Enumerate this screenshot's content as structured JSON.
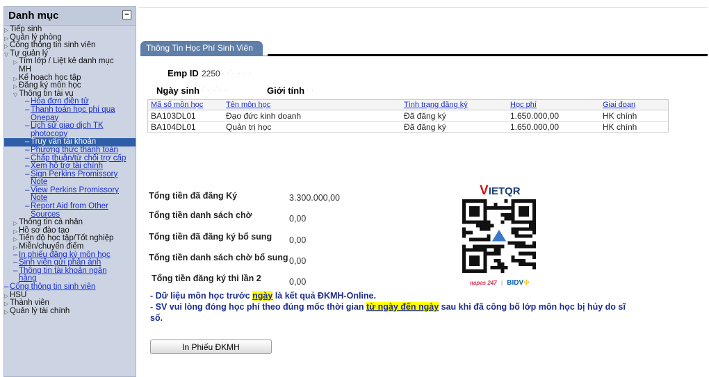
{
  "sidebar": {
    "title": "Danh mục",
    "toggle": "−",
    "items": [
      {
        "text": "Tiếp sinh",
        "level": 0,
        "arrow": "▷",
        "link": false
      },
      {
        "text": "Quản lý phòng",
        "level": 0,
        "arrow": "▷",
        "link": false
      },
      {
        "text": "Cổng thông tin sinh viên",
        "level": 0,
        "arrow": "▷",
        "link": false
      },
      {
        "text": "Tự quản lý",
        "level": 0,
        "arrow": "▽",
        "link": false
      },
      {
        "text": "Tìm lớp / Liệt kê danh mục MH",
        "level": 1,
        "arrow": "▷",
        "link": false
      },
      {
        "text": "Kế hoạch học tập",
        "level": 1,
        "arrow": "▷",
        "link": false
      },
      {
        "text": "Đăng ký môn học",
        "level": 1,
        "arrow": "▷",
        "link": false
      },
      {
        "text": "Thông tin tài vụ",
        "level": 1,
        "arrow": "▽",
        "link": false
      },
      {
        "text": "Hóa đơn điện tử",
        "level": 2,
        "link": true
      },
      {
        "text": "Thanh toán học phí qua Onepay",
        "level": 2,
        "link": true
      },
      {
        "text": "Lịch sử giao dịch TK photocopy",
        "level": 2,
        "link": true
      },
      {
        "text": "Truy vấn tài khoản",
        "level": 2,
        "link": true,
        "selected": true
      },
      {
        "text": "Phương thức thanh toán",
        "level": 2,
        "link": true
      },
      {
        "text": "Chấp thuận/từ chối trợ cấp",
        "level": 2,
        "link": true
      },
      {
        "text": "Xem hỗ trợ tài chính",
        "level": 2,
        "link": true
      },
      {
        "text": "Sign Perkins Promissory Note",
        "level": 2,
        "link": true
      },
      {
        "text": "View Perkins Promissory Note",
        "level": 2,
        "link": true
      },
      {
        "text": "Report Aid from Other Sources",
        "level": 2,
        "link": true
      },
      {
        "text": "Thông tin cá nhân",
        "level": 1,
        "arrow": "▷",
        "link": false
      },
      {
        "text": "Hồ sơ đào tạo",
        "level": 1,
        "arrow": "▷",
        "link": false
      },
      {
        "text": "Tiến độ học tập/Tốt nghiệp",
        "level": 1,
        "arrow": "▷",
        "link": false
      },
      {
        "text": "Miễn/chuyển điểm",
        "level": 1,
        "arrow": "▷",
        "link": false
      },
      {
        "text": "In phiếu đăng ký môn học",
        "level": 1,
        "dash": true,
        "link": true
      },
      {
        "text": "Sinh viên gửi phản ánh",
        "level": 1,
        "dash": true,
        "link": true
      },
      {
        "text": "Thông tin tài khoản ngân hàng",
        "level": 1,
        "dash": true,
        "link": true
      },
      {
        "text": "Cổng thông tin sinh viên",
        "level": 0,
        "dash": true,
        "link": true
      },
      {
        "text": "HSU",
        "level": 0,
        "arrow": "▷",
        "link": false
      },
      {
        "text": "Thành viên",
        "level": 0,
        "arrow": "▷",
        "link": false
      },
      {
        "text": "Quản lý tài chính",
        "level": 0,
        "arrow": "▷",
        "link": false
      }
    ]
  },
  "tab": {
    "label": "Thông Tin Học Phí Sinh Viên"
  },
  "info": {
    "emp_label": "Emp ID",
    "emp_value": "2250",
    "dob_label": "Ngày sinh",
    "gender_label": "Giới tính"
  },
  "table": {
    "headers": [
      "Mã số môn học",
      "Tên môn học",
      "Tình trạng đăng ký",
      "Học phí",
      "Giai đoạn"
    ],
    "rows": [
      [
        "BA103DL01",
        "Đạo đức kinh doanh",
        "Đã đăng ký",
        "1.650.000,00",
        "HK chính"
      ],
      [
        "BA104DL01",
        "Quản trị học",
        "Đã đăng ký",
        "1.650.000,00",
        "HK chính"
      ]
    ]
  },
  "totals": [
    {
      "label": "Tổng tiền đã đăng Ký",
      "value": "3.300.000,00"
    },
    {
      "label": "Tổng tiền danh sách chờ",
      "value": "0,00"
    },
    {
      "label": "Tổng tiền đã đăng ký bổ sung",
      "value": "0,00"
    },
    {
      "label": "Tổng tiền danh sách chờ bổ sung",
      "value": "0,00"
    },
    {
      "label": "Tổng tiền đăng ký thi lần 2",
      "value": "0,00"
    }
  ],
  "qr": {
    "brand_v": "V",
    "brand_rest": "IETQR",
    "napas": "napas 247",
    "bank": "BIDV"
  },
  "notes": {
    "n1_pre": "- Dữ liệu môn học trước ",
    "n1_hl": "ngày",
    "n1_post": " là kết quả ĐKMH-Online.",
    "n2_pre": "- SV vui lòng đóng học phí theo đúng mốc thời gian ",
    "n2_hl": "từ ngày đến ngày",
    "n2_post": " sau khi đã công bố lớp môn học bị hủy do sĩ",
    "n2_cont": "số."
  },
  "colors": {
    "tab": "#5f7fa9",
    "sidebar": "#ccd4e3",
    "selected": "#2f5ea8",
    "link": "#1a2ecc",
    "highlight": "#ffff00"
  },
  "button": {
    "label": "In Phiếu ĐKMH"
  }
}
